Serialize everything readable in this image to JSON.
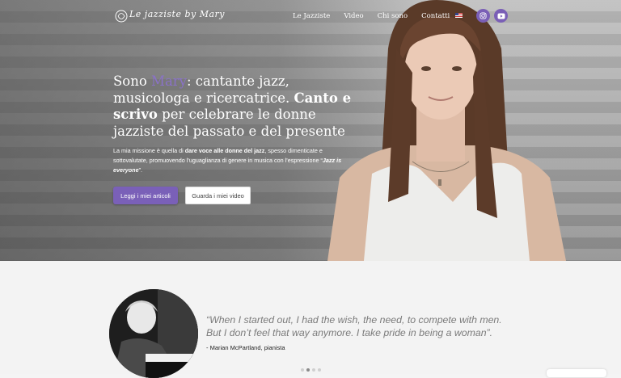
{
  "brand": {
    "logo_text": "Le jazziste by Mary"
  },
  "nav": {
    "items": [
      {
        "label": "Le Jazziste"
      },
      {
        "label": "Video"
      },
      {
        "label": "Chi sono"
      },
      {
        "label": "Contatti"
      }
    ],
    "language_flag": "us-flag-icon"
  },
  "social": {
    "instagram": "instagram-icon",
    "youtube": "youtube-icon"
  },
  "hero": {
    "headline_part1": "Sono ",
    "headline_name": "Mary",
    "headline_part2": ": cantante jazz, musicologa e ricercatrice. ",
    "headline_bold": "Canto e scrivo",
    "headline_part3": " per celebrare le donne jazziste del passato e del presente",
    "mission_part1": "La mia missione è quella di ",
    "mission_bold": "dare voce alle donne del jazz",
    "mission_part2": ", spesso dimenticate e sottovalutate, promuovendo l’uguaglianza di genere in musica con l’espressione “",
    "mission_quote": "Jazz is everyone",
    "mission_part3": "”.",
    "primary_button": "Leggi i miei articoli",
    "secondary_button": "Guarda i miei video"
  },
  "testimonial": {
    "quote": "“When I started out, I had the wish, the need, to compete with men. But I don’t feel that way anymore. I take pride in being a woman”.",
    "attribution": "- Marian McPartland, pianista",
    "slides_total": 4,
    "active_slide": 2
  },
  "colors": {
    "accent": "#7a60b8",
    "name_highlight": "#8a72c7"
  }
}
